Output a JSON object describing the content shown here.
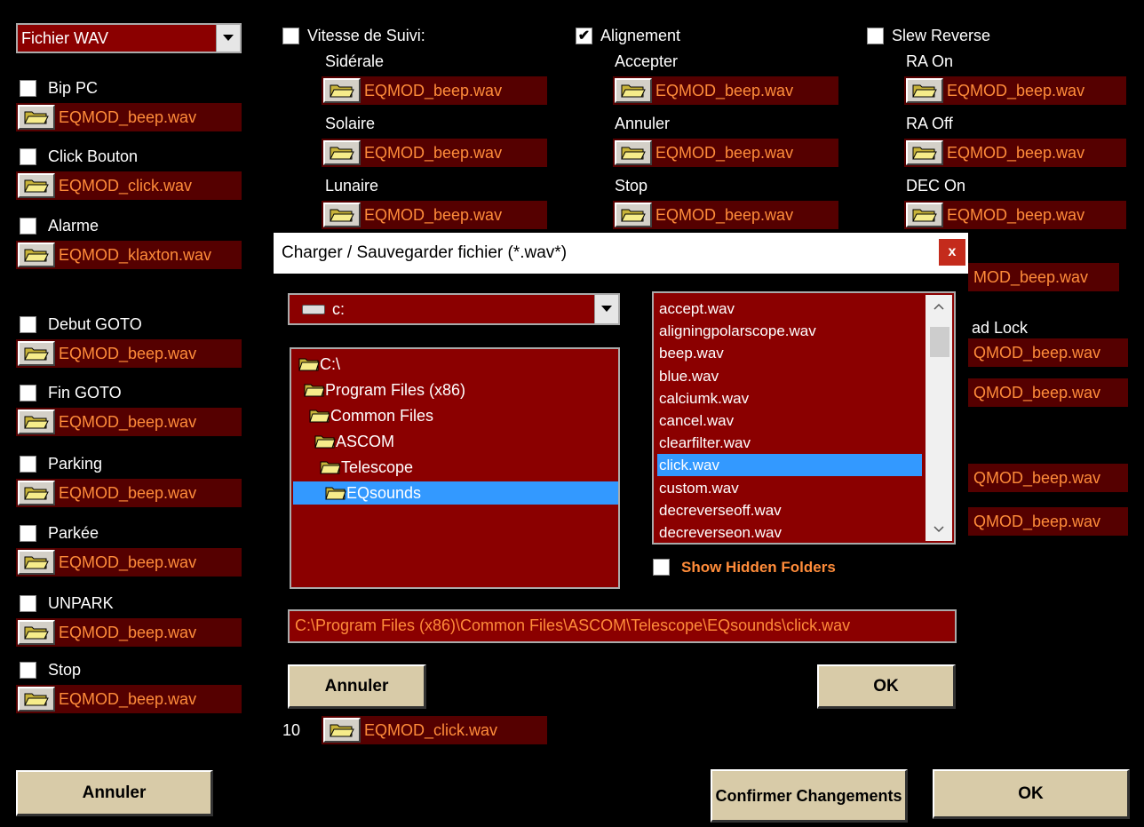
{
  "sound_source": {
    "selected": "Fichier WAV"
  },
  "left_events": [
    {
      "label": "Bip PC",
      "checked": false,
      "file": "EQMOD_beep.wav"
    },
    {
      "label": "Click Bouton",
      "checked": false,
      "file": "EQMOD_click.wav"
    },
    {
      "label": "Alarme",
      "checked": false,
      "file": "EQMOD_klaxton.wav"
    },
    {
      "label": "Debut GOTO",
      "checked": false,
      "file": "EQMOD_beep.wav"
    },
    {
      "label": "Fin GOTO",
      "checked": false,
      "file": "EQMOD_beep.wav"
    },
    {
      "label": "Parking",
      "checked": false,
      "file": "EQMOD_beep.wav"
    },
    {
      "label": "Parkée",
      "checked": false,
      "file": "EQMOD_beep.wav"
    },
    {
      "label": "UNPARK",
      "checked": false,
      "file": "EQMOD_beep.wav"
    },
    {
      "label": "Stop",
      "checked": false,
      "file": "EQMOD_beep.wav"
    }
  ],
  "columns": {
    "tracking": {
      "label": "Vitesse de Suivi:",
      "checked": false,
      "items": [
        {
          "label": "Sidérale",
          "file": "EQMOD_beep.wav"
        },
        {
          "label": "Solaire",
          "file": "EQMOD_beep.wav"
        },
        {
          "label": "Lunaire",
          "file": "EQMOD_beep.wav"
        }
      ],
      "partial_row": {
        "label": "10",
        "file": "EQMOD_click.wav"
      }
    },
    "alignment": {
      "label": "Alignement",
      "checked": true,
      "items": [
        {
          "label": "Accepter",
          "file": "EQMOD_beep.wav"
        },
        {
          "label": "Annuler",
          "file": "EQMOD_beep.wav"
        },
        {
          "label": "Stop",
          "file": "EQMOD_beep.wav"
        }
      ]
    },
    "slew": {
      "label": "Slew Reverse",
      "checked": false,
      "items": [
        {
          "label": "RA On",
          "file": "EQMOD_beep.wav"
        },
        {
          "label": "RA Off",
          "file": "EQMOD_beep.wav"
        },
        {
          "label": "DEC On",
          "file": "EQMOD_beep.wav"
        }
      ],
      "hidden_fragments": {
        "r1": "MOD_beep.wav",
        "lock_label": "ad Lock",
        "r2": "QMOD_beep.wav",
        "r3": "QMOD_beep.wav",
        "r4": "QMOD_beep.wav",
        "r5": "QMOD_beep.wav"
      }
    }
  },
  "bottom": {
    "cancel": "Annuler",
    "confirm": "Confirmer Changements",
    "ok": "OK"
  },
  "dialog": {
    "title": "Charger / Sauvegarder fichier (*.wav*)",
    "close": "x",
    "drive": "c:",
    "folders": [
      "C:\\",
      "Program Files (x86)",
      "Common Files",
      "ASCOM",
      "Telescope",
      "EQsounds"
    ],
    "selected_folder": "EQsounds",
    "files": [
      "accept.wav",
      "aligningpolarscope.wav",
      "beep.wav",
      "blue.wav",
      "calciumk.wav",
      "cancel.wav",
      "clearfilter.wav",
      "click.wav",
      "custom.wav",
      "decreverseoff.wav",
      "decreverseon.wav"
    ],
    "selected_file": "click.wav",
    "show_hidden_label": "Show Hidden Folders",
    "show_hidden_checked": false,
    "path": "C:\\Program Files (x86)\\Common Files\\ASCOM\\Telescope\\EQsounds\\click.wav",
    "cancel": "Annuler",
    "ok": "OK"
  },
  "colors": {
    "panel": "#8b0000",
    "filename": "#ff8c3a",
    "selection": "#3399ff",
    "button": "#d8cba8"
  }
}
